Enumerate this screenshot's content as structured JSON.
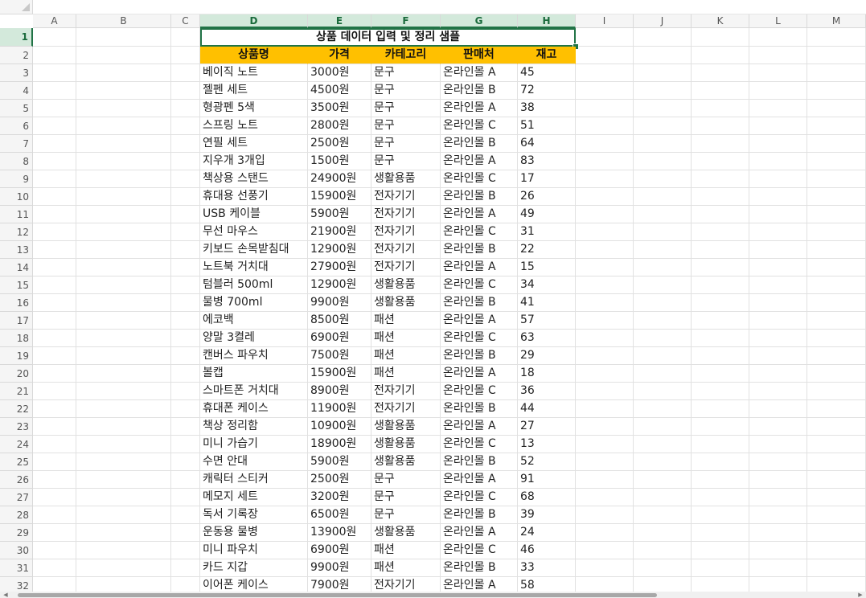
{
  "columns": [
    "A",
    "B",
    "C",
    "D",
    "E",
    "F",
    "G",
    "H",
    "I",
    "J",
    "K",
    "L",
    "M"
  ],
  "selected_columns": [
    "D",
    "E",
    "F",
    "G",
    "H"
  ],
  "selected_row": 1,
  "row_numbers": [
    "1",
    "2",
    "3",
    "4",
    "5",
    "6",
    "7",
    "8",
    "9",
    "10",
    "11",
    "12",
    "13",
    "14",
    "15",
    "16",
    "17",
    "18",
    "19",
    "20",
    "21",
    "22",
    "23",
    "24",
    "25",
    "26",
    "27",
    "28",
    "29",
    "30",
    "31",
    "32"
  ],
  "title": "상품 데이터 입력 및 정리 샘플",
  "headers": [
    "상품명",
    "가격",
    "카테고리",
    "판매처",
    "재고"
  ],
  "rows": [
    [
      "베이직 노트",
      "3000원",
      "문구",
      "온라인몰 A",
      "45"
    ],
    [
      "젤펜 세트",
      "4500원",
      "문구",
      "온라인몰 B",
      "72"
    ],
    [
      "형광펜 5색",
      "3500원",
      "문구",
      "온라인몰 A",
      "38"
    ],
    [
      "스프링 노트",
      "2800원",
      "문구",
      "온라인몰 C",
      "51"
    ],
    [
      "연필 세트",
      "2500원",
      "문구",
      "온라인몰 B",
      "64"
    ],
    [
      "지우개 3개입",
      "1500원",
      "문구",
      "온라인몰 A",
      "83"
    ],
    [
      "책상용 스탠드",
      "24900원",
      "생활용품",
      "온라인몰 C",
      "17"
    ],
    [
      "휴대용 선풍기",
      "15900원",
      "전자기기",
      "온라인몰 B",
      "26"
    ],
    [
      "USB 케이블",
      "5900원",
      "전자기기",
      "온라인몰 A",
      "49"
    ],
    [
      "무선 마우스",
      "21900원",
      "전자기기",
      "온라인몰 C",
      "31"
    ],
    [
      "키보드 손목받침대",
      "12900원",
      "전자기기",
      "온라인몰 B",
      "22"
    ],
    [
      "노트북 거치대",
      "27900원",
      "전자기기",
      "온라인몰 A",
      "15"
    ],
    [
      "텀블러 500ml",
      "12900원",
      "생활용품",
      "온라인몰 C",
      "34"
    ],
    [
      "물병 700ml",
      "9900원",
      "생활용품",
      "온라인몰 B",
      "41"
    ],
    [
      "에코백",
      "8500원",
      "패션",
      "온라인몰 A",
      "57"
    ],
    [
      "양말 3켤레",
      "6900원",
      "패션",
      "온라인몰 C",
      "63"
    ],
    [
      "캔버스 파우치",
      "7500원",
      "패션",
      "온라인몰 B",
      "29"
    ],
    [
      "볼캡",
      "15900원",
      "패션",
      "온라인몰 A",
      "18"
    ],
    [
      "스마트폰 거치대",
      "8900원",
      "전자기기",
      "온라인몰 C",
      "36"
    ],
    [
      "휴대폰 케이스",
      "11900원",
      "전자기기",
      "온라인몰 B",
      "44"
    ],
    [
      "책상 정리함",
      "10900원",
      "생활용품",
      "온라인몰 A",
      "27"
    ],
    [
      "미니 가습기",
      "18900원",
      "생활용품",
      "온라인몰 C",
      "13"
    ],
    [
      "수면 안대",
      "5900원",
      "생활용품",
      "온라인몰 B",
      "52"
    ],
    [
      "캐릭터 스티커",
      "2500원",
      "문구",
      "온라인몰 A",
      "91"
    ],
    [
      "메모지 세트",
      "3200원",
      "문구",
      "온라인몰 C",
      "68"
    ],
    [
      "독서 기록장",
      "6500원",
      "문구",
      "온라인몰 B",
      "39"
    ],
    [
      "운동용 물병",
      "13900원",
      "생활용품",
      "온라인몰 A",
      "24"
    ],
    [
      "미니 파우치",
      "6900원",
      "패션",
      "온라인몰 C",
      "46"
    ],
    [
      "카드 지갑",
      "9900원",
      "패션",
      "온라인몰 B",
      "33"
    ],
    [
      "이어폰 케이스",
      "7900원",
      "전자기기",
      "온라인몰 A",
      "58"
    ]
  ],
  "colors": {
    "header_fill": "#ffc000",
    "selection": "#217346",
    "selected_header_bg": "#d3e9db"
  }
}
